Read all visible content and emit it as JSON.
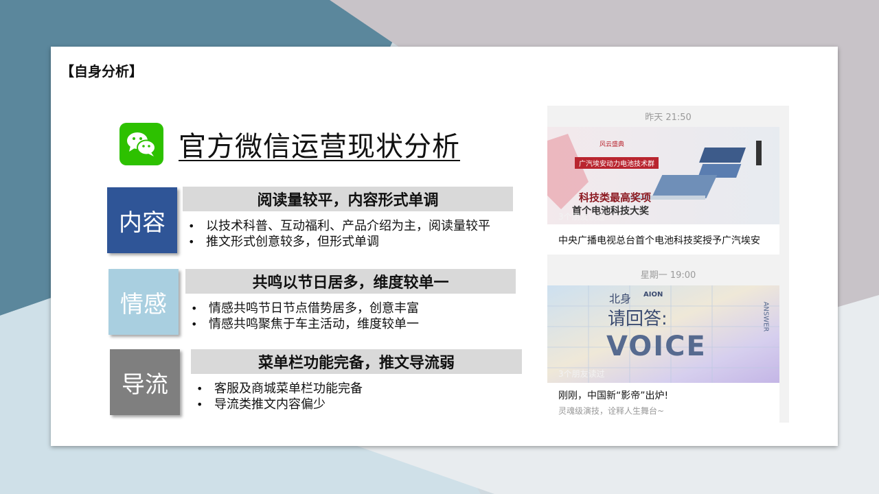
{
  "slide": {
    "section_tag": "【自身分析】",
    "title": "官方微信运营现状分析",
    "icon": "wechat-icon"
  },
  "blocks": [
    {
      "tile": "内容",
      "tile_color": "#2f5597",
      "heading": "阅读量较平，内容形式单调",
      "bullets": [
        "以技术科普、互动福利、产品介绍为主，阅读量较平",
        "推文形式创意较多，但形式单调"
      ]
    },
    {
      "tile": "情感",
      "tile_color": "#a9cfe0",
      "heading": "共鸣以节日居多，维度较单一",
      "bullets": [
        "情感共鸣节日节点借势居多，创意丰富",
        "情感共鸣聚焦于车主活动，维度较单一"
      ]
    },
    {
      "tile": "导流",
      "tile_color": "#7f7f7f",
      "heading": "菜单栏功能完备，推文导流弱",
      "bullets": [
        "客服及商城菜单栏功能完备",
        "导流类推文内容偏少"
      ]
    }
  ],
  "feed": {
    "posts": [
      {
        "timestamp": "昨天 21:50",
        "friends_read": "3个朋友读过",
        "image_text": {
          "brand": "风云盛典",
          "line1": "广汽埃安动力电池技术群",
          "line2": "科技类最高奖项",
          "line3": "首个电池科技大奖"
        },
        "caption": "中央广播电视总台首个电池科技奖授予广汽埃安",
        "subcaption": ""
      },
      {
        "timestamp": "星期一 19:00",
        "friends_read": "3个朋友读过",
        "image_text": {
          "logo": "AION",
          "line1": "北身",
          "line2": "请回答:",
          "line3": "VOICE",
          "side": "ANSWER"
        },
        "caption": "刚刚，中国新“影帝”出炉!",
        "subcaption": "灵魂级演技，诠释人生舞台~"
      }
    ]
  }
}
